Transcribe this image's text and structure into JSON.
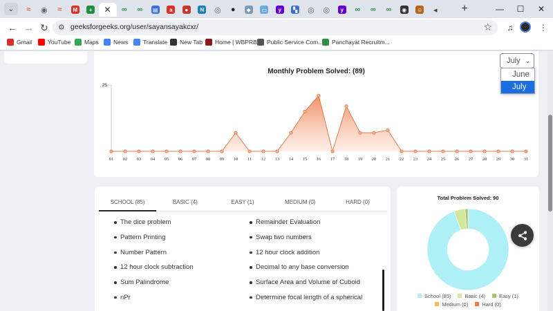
{
  "browser": {
    "tabs": [
      {
        "icon": "wave-icon",
        "color": "#e06b2e"
      },
      {
        "icon": "chrome-icon",
        "color": "#5f6368"
      },
      {
        "icon": "wave-icon",
        "color": "#e06b2e"
      },
      {
        "icon": "gmail-icon",
        "color": "#d93025"
      },
      {
        "icon": "plus-square-icon",
        "color": "#1e8e3e"
      },
      {
        "icon": "close-icon",
        "color": "#333333",
        "active": true
      },
      {
        "icon": "gfg-icon",
        "color": "#2f8d46"
      },
      {
        "icon": "gfg-icon",
        "color": "#2f8d46"
      },
      {
        "icon": "printer-icon",
        "color": "#3b6fd4"
      },
      {
        "icon": "asr-icon",
        "color": "#d93025"
      },
      {
        "icon": "red-badge-icon",
        "color": "#c0392b"
      },
      {
        "icon": "n-icon",
        "color": "#1a7fb6"
      },
      {
        "icon": "globe-icon",
        "color": "#5f6368"
      },
      {
        "icon": "github-icon",
        "color": "#222222"
      },
      {
        "icon": "drop-icon",
        "color": "#7a9bb5"
      },
      {
        "icon": "tablet-icon",
        "color": "#6fa8dc"
      },
      {
        "icon": "yahoo-icon",
        "color": "#6001d2"
      },
      {
        "icon": "flag-icon",
        "color": "#3b6fd4"
      },
      {
        "icon": "globe-icon",
        "color": "#5f6368"
      },
      {
        "icon": "globe-icon",
        "color": "#5f6368"
      },
      {
        "icon": "yahoo-icon",
        "color": "#6001d2"
      },
      {
        "icon": "gfg-icon",
        "color": "#2f8d46"
      },
      {
        "icon": "gfg-icon",
        "color": "#2f8d46"
      },
      {
        "icon": "gfg-icon",
        "color": "#2f8d46"
      },
      {
        "icon": "camera-icon",
        "color": "#333333"
      },
      {
        "icon": "person-icon",
        "color": "#b5651d"
      },
      {
        "icon": "speaker-icon",
        "color": "#444444"
      }
    ],
    "url": "geeksforgeeks.org/user/sayansayakcxr/",
    "bookmarks": [
      {
        "label": "Gmail",
        "icon": "gmail-icon",
        "color": "#d93025"
      },
      {
        "label": "YouTube",
        "icon": "youtube-icon",
        "color": "#ff0000"
      },
      {
        "label": "Maps",
        "icon": "maps-icon",
        "color": "#34a853"
      },
      {
        "label": "News",
        "icon": "news-icon",
        "color": "#4285f4"
      },
      {
        "label": "Translate",
        "icon": "translate-icon",
        "color": "#4285f4"
      },
      {
        "label": "New Tab",
        "icon": "globe-icon",
        "color": "#333333"
      },
      {
        "label": "Home | WBPRB",
        "icon": "emblem-icon",
        "color": "#8b1a1a"
      },
      {
        "label": "Public Service Com...",
        "icon": "emblem-icon",
        "color": "#555555"
      },
      {
        "label": "Panchayat Recruitm...",
        "icon": "leaf-icon",
        "color": "#2f8d46"
      }
    ]
  },
  "month_filter": {
    "selected": "July",
    "options": [
      "June",
      "July"
    ]
  },
  "monthly_chart": {
    "title": "Monthly Problem Solved: (89)"
  },
  "chart_data": [
    {
      "type": "area",
      "title": "Monthly Problem Solved: (89)",
      "categories": [
        "01",
        "02",
        "03",
        "04",
        "05",
        "06",
        "07",
        "08",
        "09",
        "10",
        "11",
        "12",
        "13",
        "14",
        "15",
        "16",
        "17",
        "18",
        "19",
        "20",
        "21",
        "22",
        "23",
        "24",
        "25",
        "26",
        "27",
        "28",
        "29",
        "30",
        "31"
      ],
      "values": [
        0,
        0,
        0,
        0,
        0,
        0,
        0,
        0,
        0,
        7,
        0,
        0,
        0,
        7,
        15,
        21,
        0,
        17,
        7,
        7,
        8,
        0,
        0,
        0,
        0,
        0,
        0,
        0,
        0,
        0,
        0
      ],
      "ylim": [
        0,
        25
      ],
      "yticks": [
        "25"
      ],
      "colors": {
        "line": "#e07b4f",
        "fill_top": "#f08a5d",
        "fill_bottom": "#fde3d6"
      }
    },
    {
      "type": "pie",
      "title": "Total Problem Solved: 90",
      "series": [
        {
          "name": "School (85)",
          "value": 85,
          "color": "#aef0f5"
        },
        {
          "name": "Basic (4)",
          "value": 4,
          "color": "#d4e79e"
        },
        {
          "name": "Easy (1)",
          "value": 1,
          "color": "#a8c66c"
        },
        {
          "name": "Medium (0)",
          "value": 0,
          "color": "#f5b763"
        },
        {
          "name": "Hard (0)",
          "value": 0,
          "color": "#f07c4b"
        }
      ]
    }
  ],
  "problem_tabs": [
    "SCHOOL (85)",
    "BASIC (4)",
    "EASY (1)",
    "MEDIUM (0)",
    "HARD (0)"
  ],
  "problems_col1": [
    "The dice problem",
    "Pattern Printing",
    "Number Pattern",
    "12 hour clock subtraction",
    "Sum Palindrome",
    "nPr"
  ],
  "problems_col2": [
    "Remainder Evaluation",
    "Swap two numbers",
    "12 hour clock addition",
    "Decimal to any base conversion",
    "Surface Area and Volume of Cuboid",
    "Determine focal length of a spherical"
  ],
  "share": {
    "icon": "share-icon"
  }
}
